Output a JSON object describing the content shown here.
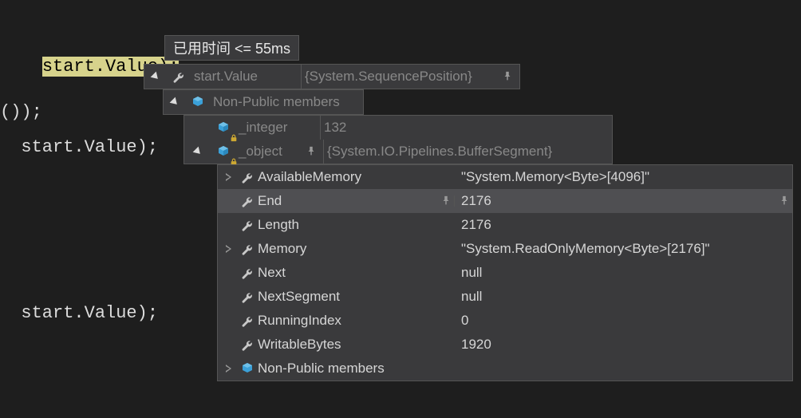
{
  "code": {
    "highlighted_fragment": "start.Value);",
    "line2_text": "());",
    "line3_prefix": "  start",
    "line3_dot": ".",
    "line3_member": "Value",
    "line3_rest": "); ",
    "line4_prefix": "  start",
    "line4_dot": ".",
    "line4_member": "Value",
    "line4_rest": ");"
  },
  "timing": {
    "label": "已用时间 <= 55ms"
  },
  "tip1": {
    "name": "start.Value",
    "value": "{System.SequencePosition}"
  },
  "tip2": {
    "label": "Non-Public members"
  },
  "tip3": {
    "row_integer": {
      "name": "_integer",
      "value": "132"
    },
    "row_object": {
      "name": "_object",
      "value": "{System.IO.Pipelines.BufferSegment}"
    }
  },
  "props": {
    "rows": [
      {
        "expandable": true,
        "name": "AvailableMemory",
        "value": "\"System.Memory<Byte>[4096]\""
      },
      {
        "expandable": false,
        "name": "End",
        "value": "2176",
        "selected": true
      },
      {
        "expandable": false,
        "name": "Length",
        "value": "2176"
      },
      {
        "expandable": true,
        "name": "Memory",
        "value": "\"System.ReadOnlyMemory<Byte>[2176]\""
      },
      {
        "expandable": false,
        "name": "Next",
        "value": "null"
      },
      {
        "expandable": false,
        "name": "NextSegment",
        "value": "null"
      },
      {
        "expandable": false,
        "name": "RunningIndex",
        "value": "0"
      },
      {
        "expandable": false,
        "name": "WritableBytes",
        "value": "1920"
      }
    ],
    "non_public_label": "Non-Public members"
  }
}
